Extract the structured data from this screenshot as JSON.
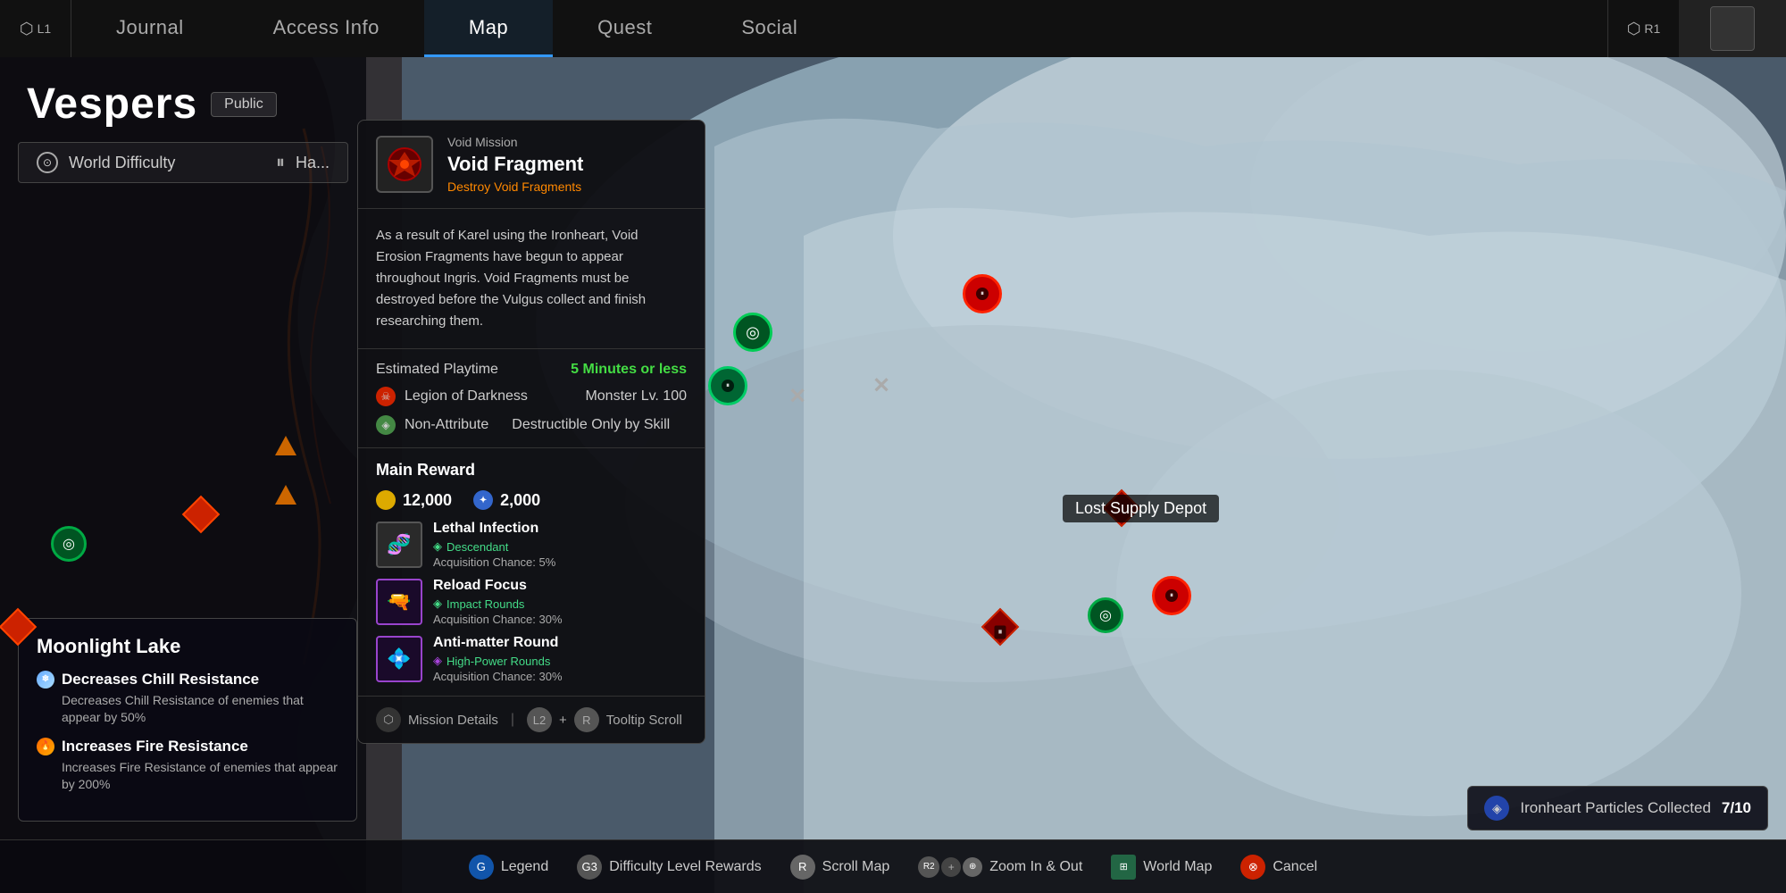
{
  "nav": {
    "left_button": "L1",
    "right_button": "R1",
    "tabs": [
      {
        "label": "Journal",
        "active": false
      },
      {
        "label": "Access Info",
        "active": false
      },
      {
        "label": "Map",
        "active": true
      },
      {
        "label": "Quest",
        "active": false
      },
      {
        "label": "Social",
        "active": false
      }
    ]
  },
  "location": {
    "title": "Vespers",
    "badge": "Public",
    "world_difficulty": {
      "label": "World Difficulty",
      "value": "Ha..."
    }
  },
  "moonlight_lake": {
    "title": "Moonlight Lake",
    "effects": [
      {
        "name": "Decreases Chill Resistance",
        "desc": "Decreases Chill Resistance of enemies that appear by 50%",
        "type": "chill"
      },
      {
        "name": "Increases Fire Resistance",
        "desc": "Increases Fire Resistance of enemies that appear by 200%",
        "type": "fire"
      }
    ]
  },
  "mission": {
    "type": "Void Mission",
    "name": "Void Fragment",
    "subtitle": "Destroy Void Fragments",
    "description": "As a result of Karel using the Ironheart, Void Erosion Fragments have begun to appear throughout Ingris. Void Fragments must be destroyed before the Vulgus collect and finish researching them.",
    "estimated_playtime_label": "Estimated Playtime",
    "estimated_playtime_value": "5 Minutes or less",
    "enemy_faction": "Legion of Darkness",
    "monster_level": "Monster Lv. 100",
    "attribute_label": "Non-Attribute",
    "attribute_desc": "Destructible Only by Skill",
    "reward": {
      "title": "Main Reward",
      "gold": "12,000",
      "xp": "2,000",
      "items": [
        {
          "name": "Lethal Infection",
          "type": "Descendant",
          "chance": "Acquisition Chance: 5%",
          "color": "normal"
        },
        {
          "name": "Reload Focus",
          "type": "Impact Rounds",
          "chance": "Acquisition Chance: 30%",
          "color": "purple"
        },
        {
          "name": "Anti-matter Round",
          "type": "High-Power Rounds",
          "chance": "Acquisition Chance: 30%",
          "color": "purple"
        }
      ]
    },
    "footer": {
      "mission_details": "Mission Details",
      "tooltip_scroll": "Tooltip Scroll",
      "shortcut1": "L2",
      "shortcut2": "R"
    }
  },
  "map": {
    "lost_supply_depot_label": "Lost Supply Depot"
  },
  "ironheart": {
    "label": "Ironheart Particles Collected",
    "progress": "7/10"
  },
  "bottom_bar": {
    "items": [
      {
        "icon": "G",
        "label": "Legend"
      },
      {
        "icon": "G3",
        "label": "Difficulty Level Rewards"
      },
      {
        "icon": "R",
        "label": "Scroll Map"
      },
      {
        "icon": "R2+",
        "label": "Zoom In & Out"
      },
      {
        "icon": "WM",
        "label": "World Map"
      },
      {
        "icon": "⊗",
        "label": "Cancel"
      }
    ]
  }
}
